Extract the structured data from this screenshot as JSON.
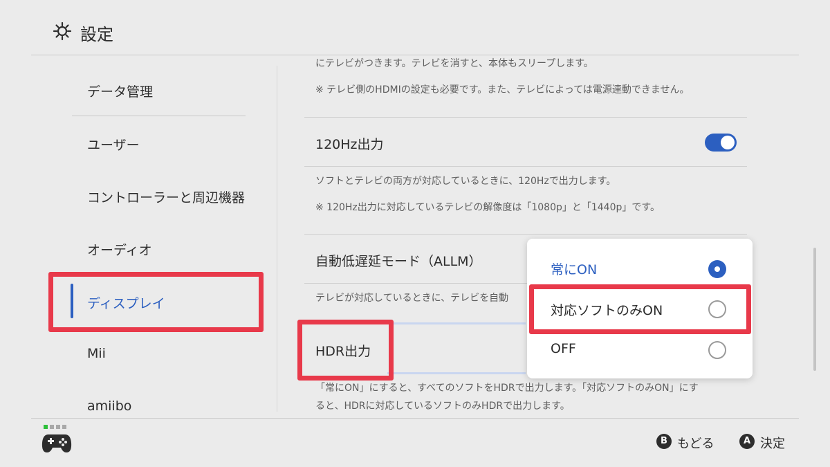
{
  "header": {
    "title": "設定"
  },
  "sidebar": {
    "items": [
      {
        "label": "データ管理"
      },
      {
        "label": "ユーザー"
      },
      {
        "label": "コントローラーと周辺機器"
      },
      {
        "label": "オーディオ"
      },
      {
        "label": "ディスプレイ",
        "active": true
      },
      {
        "label": "Mii"
      },
      {
        "label": "amiibo"
      }
    ]
  },
  "content": {
    "tv_sleep_note": "にテレビがつきます。テレビを消すと、本体もスリープします。",
    "hdmi_note": "※ テレビ側のHDMIの設定も必要です。また、テレビによっては電源連動できません。",
    "hz120": {
      "label": "120Hz出力",
      "enabled": true,
      "desc": "ソフトとテレビの両方が対応しているときに、120Hzで出力します。",
      "note": "※ 120Hz出力に対応しているテレビの解像度は「1080p」と「1440p」です。"
    },
    "allm": {
      "label": "自動低遅延モード（ALLM）",
      "desc": "テレビが対応しているときに、テレビを自動"
    },
    "hdr": {
      "label": "HDR出力",
      "desc_line1": "「常にON」にすると、すべてのソフトをHDRで出力します。「対応ソフトのみON」にす",
      "desc_line2": "ると、HDRに対応しているソフトのみHDRで出力します。"
    }
  },
  "popup": {
    "options": [
      {
        "label": "常にON",
        "selected": true
      },
      {
        "label": "対応ソフトのみON",
        "selected": false
      },
      {
        "label": "OFF",
        "selected": false
      }
    ]
  },
  "footer": {
    "back_key": "B",
    "back_label": "もどる",
    "confirm_key": "A",
    "confirm_label": "決定"
  },
  "colors": {
    "accent": "#2c5fc0",
    "annotation": "#e8394a",
    "background": "#ebebeb"
  },
  "icons": {
    "header": "gear-icon",
    "footer_controller": "controller-icon"
  }
}
